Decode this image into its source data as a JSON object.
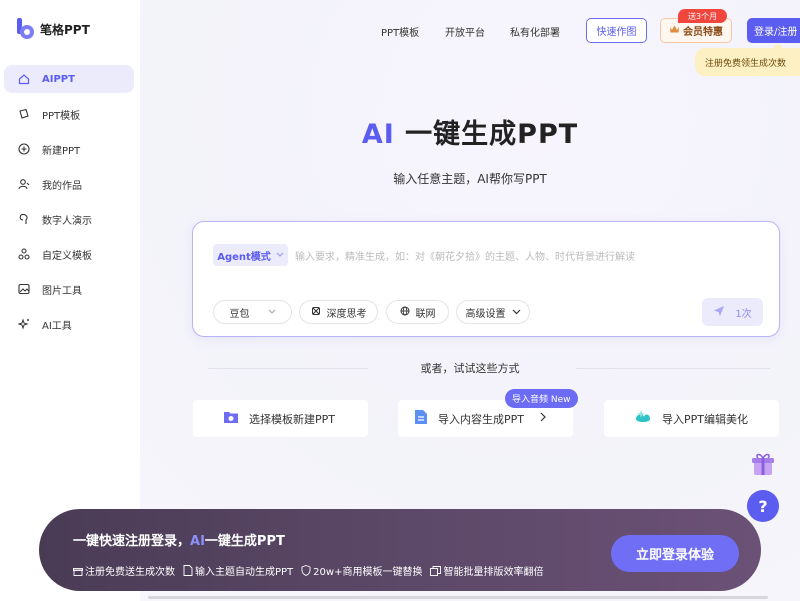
{
  "brand": {
    "name": "笔格PPT",
    "accent": "#5b5cf0"
  },
  "sidebar": {
    "items": [
      {
        "label": "AIPPT",
        "icon": "home-icon",
        "active": true
      },
      {
        "label": "PPT模板",
        "icon": "template-icon"
      },
      {
        "label": "新建PPT",
        "icon": "plus-circle-icon"
      },
      {
        "label": "我的作品",
        "icon": "user-works-icon"
      },
      {
        "label": "数字人演示",
        "icon": "digital-human-icon"
      },
      {
        "label": "自定义模板",
        "icon": "custom-template-icon"
      },
      {
        "label": "图片工具",
        "icon": "image-tool-icon"
      },
      {
        "label": "AI工具",
        "icon": "sparkle-icon"
      }
    ]
  },
  "topnav": {
    "links": [
      "PPT模板",
      "开放平台",
      "私有化部署"
    ],
    "quick_btn": "快速作图",
    "member_tag": "送3个月",
    "member_btn": "会员特惠",
    "login_btn": "登录/注册",
    "login_tip": "注册免费领生成次数"
  },
  "hero": {
    "title_ai": "AI",
    "title_rest": " 一键生成PPT",
    "subtitle": "输入任意主题，AI帮你写PPT"
  },
  "input": {
    "mode": "Agent模式",
    "placeholder": "输入要求，精准生成，如：对《朝花夕拾》的主题、人物、时代背景进行解读",
    "model": "豆包",
    "deep_think": "深度思考",
    "web": "联网",
    "advanced": "高级设置",
    "send_count": "1次"
  },
  "alternatives": {
    "divider_text": "或者，试试这些方式",
    "new_tag": "导入音频 New",
    "cards": [
      {
        "label": "选择模板新建PPT",
        "icon": "folder-icon"
      },
      {
        "label": "导入内容生成PPT",
        "icon": "document-icon"
      },
      {
        "label": "导入PPT编辑美化",
        "icon": "beautify-icon"
      }
    ]
  },
  "banner": {
    "title_prefix": "一键快速注册登录，",
    "title_ai": "AI",
    "title_suffix": "一键生成PPT",
    "features": [
      "注册免费送生成次数",
      "输入主题自动生成PPT",
      "20w+商用模板一键替换",
      "智能批量排版效率翻倍"
    ],
    "cta": "立即登录体验"
  },
  "help": "?"
}
